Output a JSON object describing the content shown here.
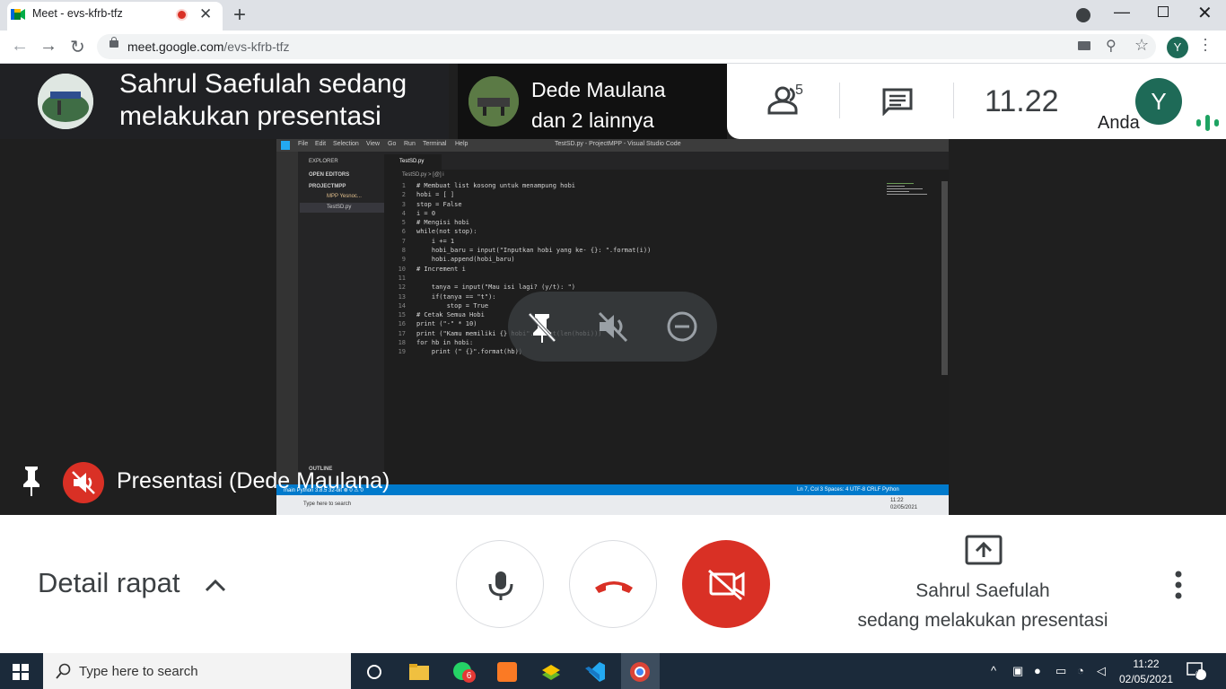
{
  "browser": {
    "tab_title": "Meet - evs-kfrb-tfz",
    "url_host": "meet.google.com",
    "url_path": "/evs-kfrb-tfz",
    "profile_initial": "Y"
  },
  "meet": {
    "presenter_text": "Sahrul Saefulah sedang melakukan presentasi",
    "participants_text_line1": "Dede Maulana",
    "participants_text_line2": "dan 2 lainnya",
    "people_count": "5",
    "clock": "11.22",
    "self_initial": "Y",
    "self_label": "Anda",
    "presentation_label": "Presentasi (Dede Maulana)",
    "meeting_details": "Detail rapat",
    "present_status_line1": "Sahrul Saefulah",
    "present_status_line2": "sedang melakukan presentasi"
  },
  "shared_screen": {
    "window_title": "TestSD.py - ProjectMPP - Visual Studio Code",
    "menu": [
      "File",
      "Edit",
      "Selection",
      "View",
      "Go",
      "Run",
      "Terminal",
      "Help"
    ],
    "explorer": "EXPLORER",
    "open_editors": "OPEN EDITORS",
    "project": "PROJECTMPP",
    "folder": "MPP Yesnoc...",
    "file": "TestSD.py",
    "outline": "OUTLINE",
    "tab": "TestSD.py",
    "breadcrumb": "TestSD.py > [@] i",
    "line_numbers": "1\n2\n3\n4\n5\n6\n7\n8\n9\n10\n11\n12\n13\n14\n15\n16\n17\n18\n19",
    "code": "# Membuat list kosong untuk menampung hobi\nhobi = [ ]\nstop = False\ni = 0\n# Mengisi hobi\nwhile(not stop):\n    i += 1\n    hobi_baru = input(\"Inputkan hobi yang ke- {}: \".format(i))\n    hobi.append(hobi_baru)\n# Increment i\n\n    tanya = input(\"Mau isi lagi? (y/t): \")\n    if(tanya == \"t\"):\n        stop = True\n# Cetak Semua Hobi\nprint (\"-\" * 10)\nprint (\"Kamu memiliki {} hobi\".format(len(hobi)))\nfor hb in hobi:\n    print (\" {}\".format(hb))",
    "status_left": "main  Python 3.8.5 32-bit  ⊗ 0 ⚠ 0",
    "status_right": "Ln 7, Col 3   Spaces: 4   UTF-8   CRLF   Python",
    "taskbar_search": "Type here to search",
    "taskbar_time": "11:22",
    "taskbar_date": "02/05/2021"
  },
  "taskbar": {
    "search_placeholder": "Type here to search",
    "whatsapp_badge": "6",
    "time": "11:22",
    "date": "02/05/2021",
    "notifications": "7"
  },
  "icons": {
    "pin": "pin-icon",
    "mute": "mic-off-icon",
    "camera_off": "camera-off-icon",
    "hangup": "hangup-icon",
    "mic": "mic-icon",
    "present": "present-icon"
  },
  "colors": {
    "meet_red": "#d93025",
    "dark_bg": "#202124",
    "vscode_blue": "#007acc"
  }
}
